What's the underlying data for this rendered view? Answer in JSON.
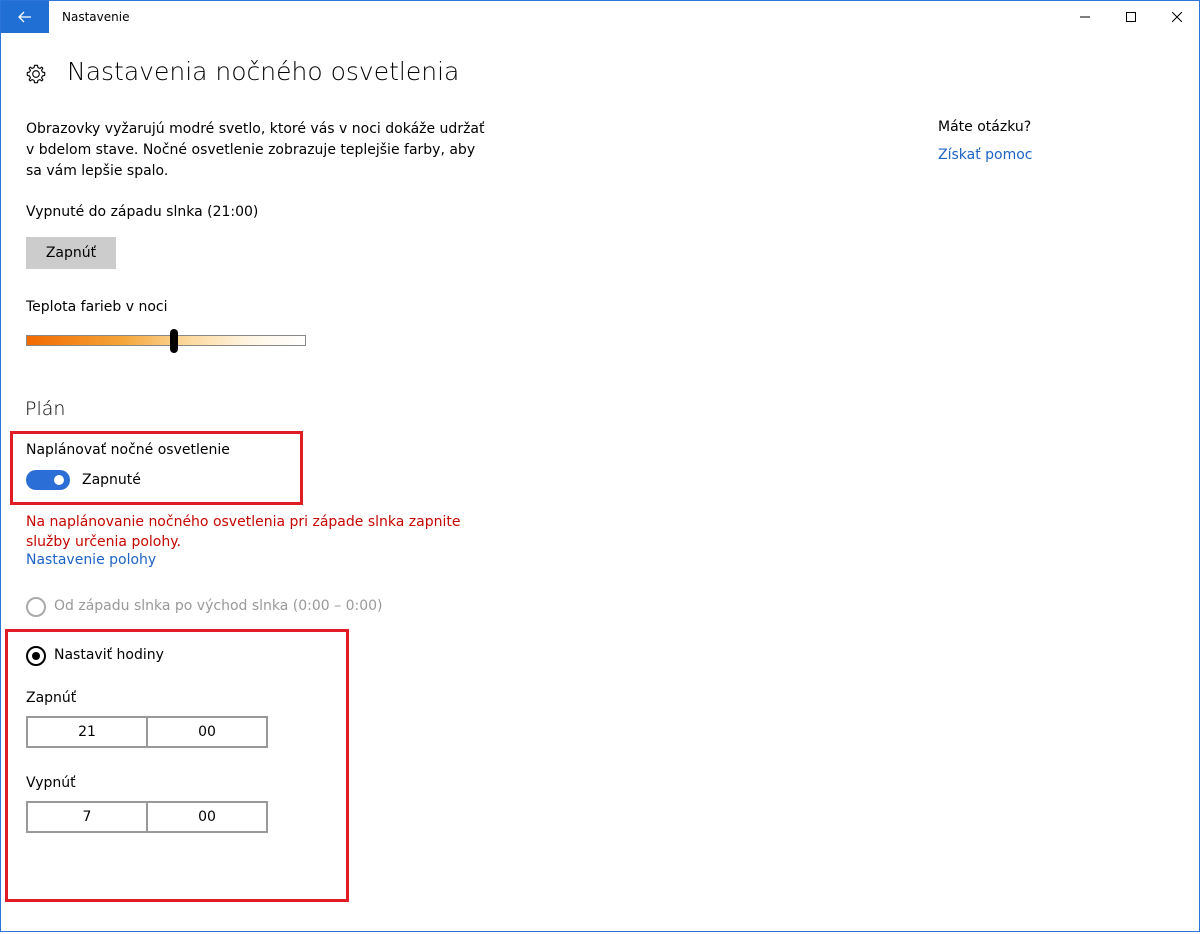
{
  "window": {
    "title": "Nastavenie"
  },
  "page": {
    "title": "Nastavenia nočného osvetlenia",
    "description": "Obrazovky vyžarujú modré svetlo, ktoré vás v noci dokáže udržať v bdelom stave. Nočné osvetlenie zobrazuje teplejšie farby, aby sa vám lepšie spalo.",
    "status": "Vypnuté do západu slnka (21:00)",
    "turn_on_button": "Zapnúť",
    "slider_label": "Teplota farieb v noci",
    "slider_value": 0.53
  },
  "plan": {
    "heading": "Plán",
    "schedule_label": "Naplánovať nočné osvetlenie",
    "toggle_state": "Zapnuté",
    "warning": "Na naplánovanie nočného osvetlenia pri západe slnka zapnite služby určenia polohy.",
    "location_link": "Nastavenie polohy",
    "option_sunset": "Od západu slnka po východ slnka (0:00 – 0:00)",
    "option_set_hours": "Nastaviť hodiny",
    "on_label": "Zapnúť",
    "on_hour": "21",
    "on_minute": "00",
    "off_label": "Vypnúť",
    "off_hour": "7",
    "off_minute": "00"
  },
  "help": {
    "title": "Máte otázku?",
    "link": "Získať pomoc"
  },
  "colors": {
    "accent": "#1f6fd4",
    "link": "#1d63c5",
    "warning": "#c50500",
    "highlight": "#e01d25"
  }
}
